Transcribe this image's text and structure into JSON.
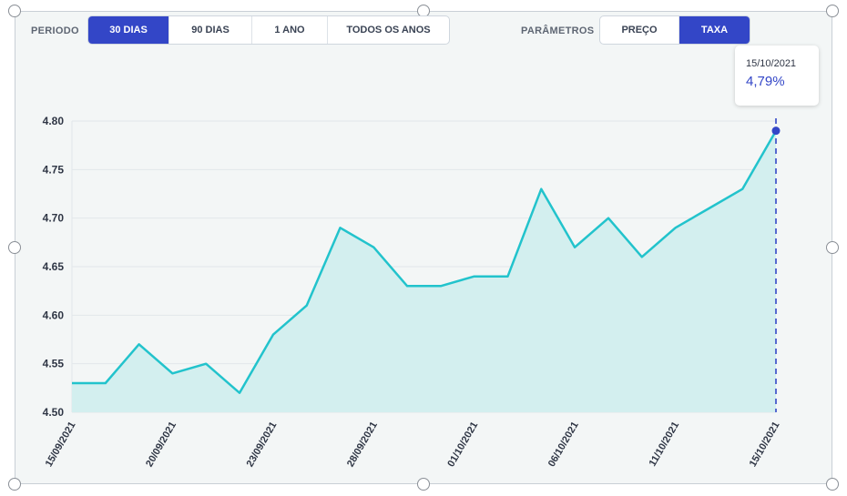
{
  "toolbar": {
    "period_label": "PERIODO",
    "period_options": [
      "30 DIAS",
      "90 DIAS",
      "1 ANO",
      "TODOS OS ANOS"
    ],
    "period_selected": "30 DIAS",
    "params_label": "PARÂMETROS",
    "param_options": [
      "PREÇO",
      "TAXA"
    ],
    "param_selected": "TAXA"
  },
  "tooltip": {
    "date": "15/10/2021",
    "value": "4,79%"
  },
  "colors": {
    "line": "#22c3cc",
    "area": "#d3efef",
    "accent": "#3346c7"
  },
  "chart_data": {
    "type": "area",
    "x_tick_labels": [
      "15/09/2021",
      "20/09/2021",
      "23/09/2021",
      "28/09/2021",
      "01/10/2021",
      "06/10/2021",
      "11/10/2021",
      "15/10/2021"
    ],
    "y_tick_labels": [
      "4.50",
      "4.55",
      "4.60",
      "4.65",
      "4.70",
      "4.75",
      "4.80"
    ],
    "ylim": [
      4.5,
      4.8
    ],
    "grid": true,
    "values": [
      4.53,
      4.53,
      4.57,
      4.54,
      4.55,
      4.52,
      4.58,
      4.61,
      4.69,
      4.67,
      4.63,
      4.63,
      4.64,
      4.64,
      4.73,
      4.67,
      4.7,
      4.66,
      4.69,
      4.71,
      4.73,
      4.79
    ],
    "highlight_index": 21
  }
}
